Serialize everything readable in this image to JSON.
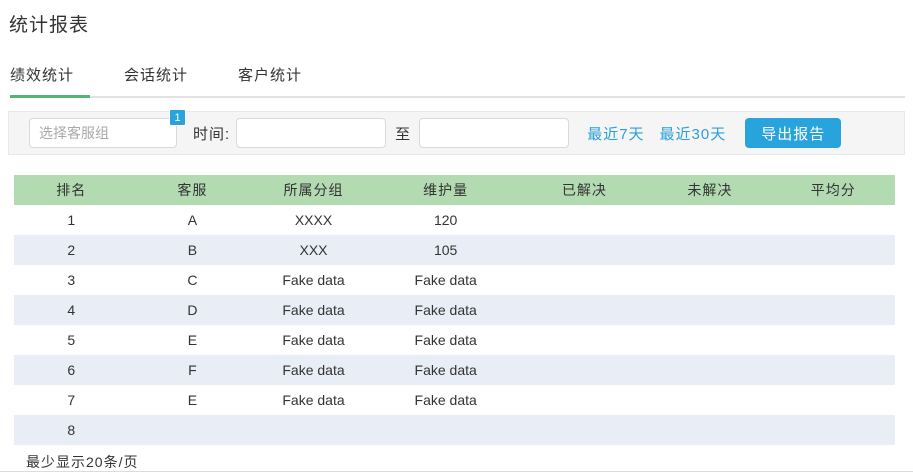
{
  "page": {
    "title": "统计报表"
  },
  "tabs": [
    {
      "label": "绩效统计",
      "active": true
    },
    {
      "label": "会话统计",
      "active": false
    },
    {
      "label": "客户统计",
      "active": false
    }
  ],
  "filters": {
    "group_placeholder": "选择客服组",
    "group_badge": "1",
    "time_label": "时间:",
    "to_label": "至",
    "date_start_value": "",
    "date_end_value": "",
    "links": [
      "最近7天",
      "最近30天"
    ],
    "export_button": "导出报告"
  },
  "table": {
    "headers": [
      "排名",
      "客服",
      "所属分组",
      "维护量",
      "已解决",
      "未解决",
      "平均分"
    ],
    "col_widths": [
      "13%",
      "14.5%",
      "13%",
      "17%",
      "14.5%",
      "14%",
      "14%"
    ],
    "rows": [
      [
        "1",
        "A",
        "XXXX",
        "120",
        "",
        "",
        ""
      ],
      [
        "2",
        "B",
        "XXX",
        "105",
        "",
        "",
        ""
      ],
      [
        "3",
        "C",
        "Fake data",
        "Fake data",
        "",
        "",
        ""
      ],
      [
        "4",
        "D",
        "Fake data",
        "Fake data",
        "",
        "",
        ""
      ],
      [
        "5",
        "E",
        "Fake data",
        "Fake data",
        "",
        "",
        ""
      ],
      [
        "6",
        "F",
        "Fake data",
        "Fake data",
        "",
        "",
        ""
      ],
      [
        "7",
        "E",
        "Fake data",
        "Fake data",
        "",
        "",
        ""
      ],
      [
        "8",
        "",
        "",
        "",
        "",
        "",
        ""
      ]
    ]
  },
  "footer": {
    "page_size_note": "最少显示20条/页"
  },
  "colors": {
    "accent_green": "#52b573",
    "header_green": "#b2dbb1",
    "stripe_blue": "#e9eef6",
    "link_blue": "#2b9fd9",
    "button_blue": "#29a3db"
  }
}
